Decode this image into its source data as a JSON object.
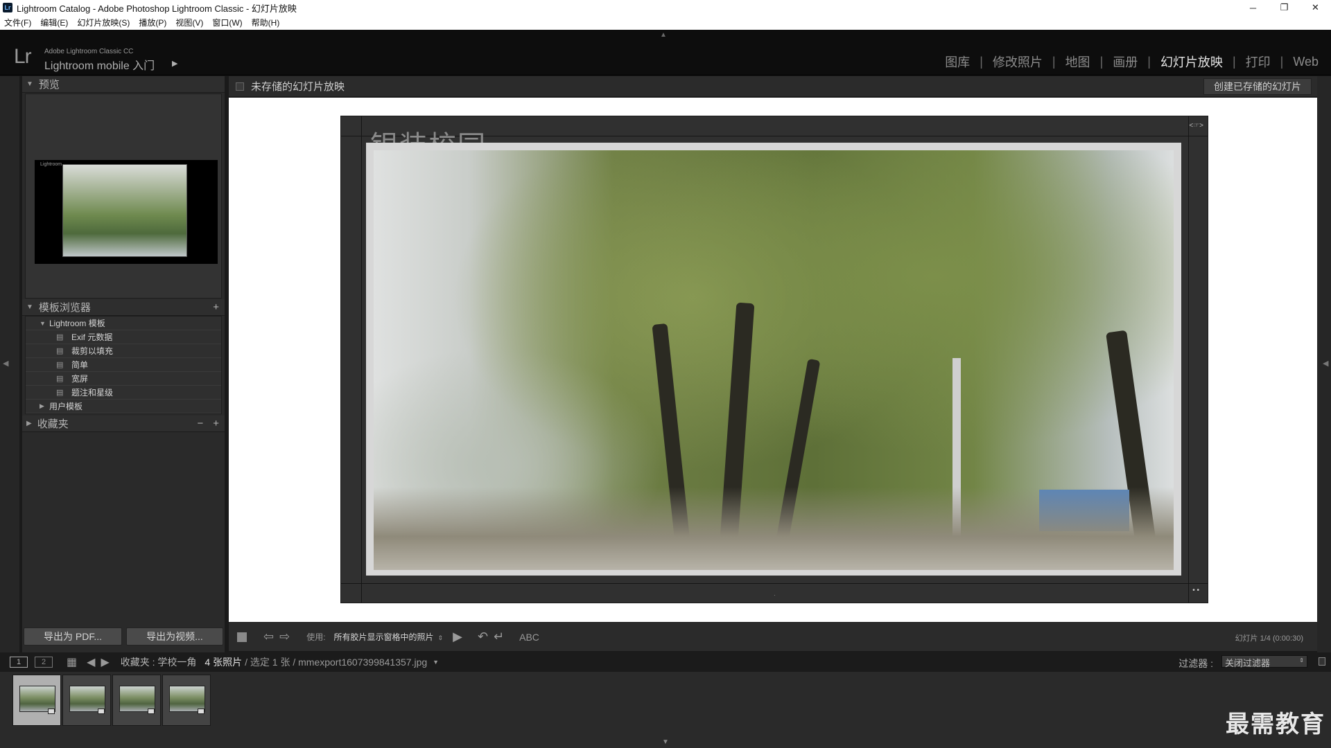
{
  "window": {
    "title": "Lightroom Catalog - Adobe Photoshop Lightroom Classic - 幻灯片放映",
    "app_icon": "Lr",
    "controls": [
      "─",
      "❐",
      "✕"
    ]
  },
  "menu": [
    "文件(F)",
    "编辑(E)",
    "幻灯片放映(S)",
    "播放(P)",
    "视图(V)",
    "窗口(W)",
    "帮助(H)"
  ],
  "identity": {
    "logo": "Lr",
    "small": "Adobe Lightroom Classic CC",
    "big": "Lightroom mobile 入门",
    "arrow": "▶"
  },
  "modules": [
    {
      "label": "图库",
      "active": false
    },
    {
      "label": "修改照片",
      "active": false
    },
    {
      "label": "地图",
      "active": false
    },
    {
      "label": "画册",
      "active": false
    },
    {
      "label": "幻灯片放映",
      "active": true
    },
    {
      "label": "打印",
      "active": false
    },
    {
      "label": "Web",
      "active": false
    }
  ],
  "left_panel": {
    "preview": {
      "title": "预览",
      "mini_label": "Lightroom"
    },
    "template_browser": {
      "title": "模板浏览器",
      "add": "+",
      "folder": "Lightroom 模板",
      "items": [
        "Exif 元数据",
        "裁剪以填充",
        "简单",
        "宽屏",
        "题注和星级"
      ],
      "user_folder": "用户模板"
    },
    "collections": {
      "title": "收藏夹",
      "minus": "−",
      "plus": "+"
    },
    "export_pdf": "导出为 PDF...",
    "export_video": "导出为视频..."
  },
  "center": {
    "header_title": "未存储的幻灯片放映",
    "save_button": "创建已存储的幻灯片",
    "slide_title": "银装校园",
    "slide_corner": "<☞>",
    "slide_dots": "• •",
    "slide_mark": "·"
  },
  "toolbar": {
    "use_label": "使用:",
    "use_value": "所有胶片显示窗格中的照片",
    "abc": "ABC",
    "slide_count": "幻灯片 1/4 (0:00:30)"
  },
  "filmnav": {
    "screen1": "1",
    "screen2": "2",
    "source": "收藏夹 : 学校一角",
    "count": "4 张照片",
    "selected": "/ 选定 1 张 / mmexport1607399841357.jpg",
    "filter_label": "过滤器 :",
    "filter_value": "关闭过滤器"
  },
  "filmstrip": {
    "thumbnail_count": 4,
    "selected_index": 0
  },
  "watermark": "最需教育",
  "colors": {
    "background": "#1a1a1a",
    "panel": "#2a2a2a",
    "canvas": "#ffffff",
    "active_module": "#e6e6e6"
  }
}
